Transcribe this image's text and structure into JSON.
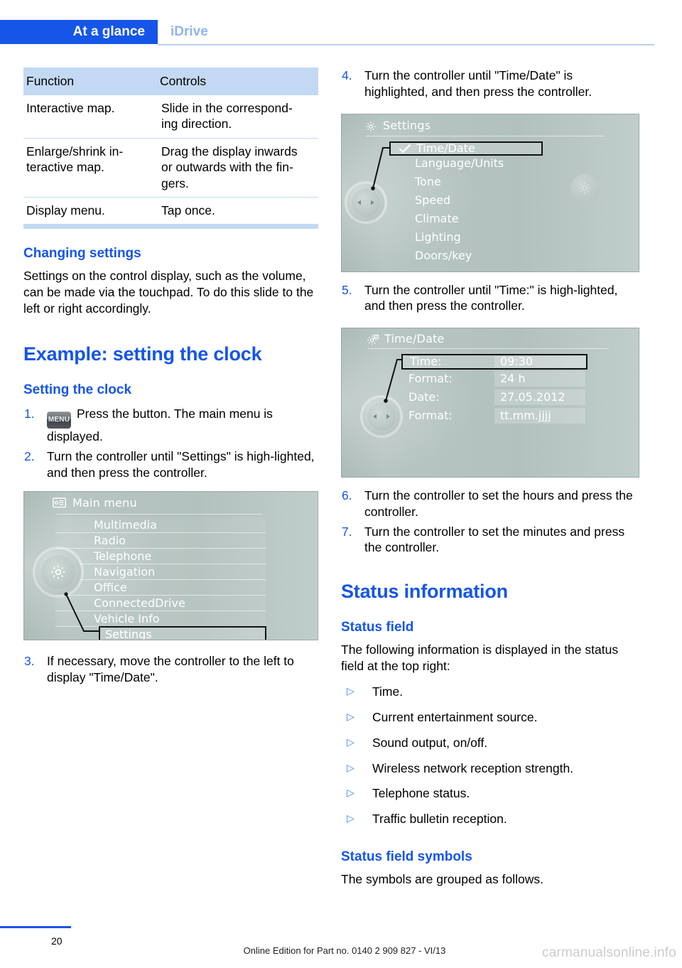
{
  "header": {
    "active_tab": "At a glance",
    "inactive_tab": "iDrive",
    "accent_color": "#1555e8"
  },
  "left_column": {
    "table": {
      "columns": [
        "Function",
        "Controls"
      ],
      "rows": [
        [
          "Interactive map.",
          "Slide in the correspond-\ning direction."
        ],
        [
          "Enlarge/shrink in-\nteractive map.",
          "Drag the display inwards\nor outwards with the fin-\ngers."
        ],
        [
          "Display menu.",
          "Tap once."
        ]
      ]
    },
    "changing_settings": {
      "heading": "Changing settings",
      "body": "Settings on the control display, such as the volume, can be made via the touchpad. To do this slide to the left or right accordingly."
    },
    "example_heading": "Example: setting the clock",
    "setting_clock_heading": "Setting the clock",
    "steps": [
      {
        "num": "1.",
        "key_label": "MENU",
        "text": "Press the button. The main menu is displayed."
      },
      {
        "num": "2.",
        "text": "Turn the controller until \"Settings\" is high-lighted, and then press the controller."
      },
      {
        "num": "3.",
        "text": "If necessary, move the controller to the left to display \"Time/Date\"."
      }
    ],
    "main_menu_screen": {
      "title": "Main menu",
      "title_icon": "list-menu-icon",
      "knob_icon": "gear-icon",
      "items": [
        "Multimedia",
        "Radio",
        "Telephone",
        "Navigation",
        "Office",
        "ConnectedDrive",
        "Vehicle Info",
        "Settings"
      ],
      "highlighted": "Settings"
    }
  },
  "right_column": {
    "steps": [
      {
        "num": "4.",
        "text": "Turn the controller until \"Time/Date\" is highlighted, and then press the controller."
      },
      {
        "num": "5.",
        "text": "Turn the controller until \"Time:\" is high-lighted, and then press the controller."
      },
      {
        "num": "6.",
        "text": "Turn the controller to set the hours and press the controller."
      },
      {
        "num": "7.",
        "text": "Turn the controller to set the minutes and press the controller."
      }
    ],
    "settings_screen": {
      "title": "Settings",
      "title_icon": "gear-icon",
      "check_icon": "checkmark-icon",
      "knob_icon": "left-right-arrows-icon",
      "side_icon": "gear-icon",
      "items": [
        "Time/Date",
        "Language/Units",
        "Tone",
        "Speed",
        "Climate",
        "Lighting",
        "Doors/key"
      ],
      "highlighted": "Time/Date"
    },
    "timedate_screen": {
      "title": "Time/Date",
      "title_icon": "gear-clock-icon",
      "knob_icon": "left-right-arrows-icon",
      "rows": [
        {
          "label": "Time:",
          "value": "09:30",
          "highlighted": true
        },
        {
          "label": "Format:",
          "value": "24 h",
          "highlighted": false
        },
        {
          "label": "Date:",
          "value": "27.05.2012",
          "highlighted": false
        },
        {
          "label": "Format:",
          "value": "tt.mm.jjjj",
          "highlighted": false
        }
      ]
    },
    "status_information_heading": "Status information",
    "status_field_heading": "Status field",
    "status_field_body": "The following information is displayed in the status field at the top right:",
    "status_bullets": [
      "Time.",
      "Current entertainment source.",
      "Sound output, on/off.",
      "Wireless network reception strength.",
      "Telephone status.",
      "Traffic bulletin reception."
    ],
    "status_symbols_heading": "Status field symbols",
    "status_symbols_body": "The symbols are grouped as follows."
  },
  "footer": {
    "page_number": "20",
    "edition_note": "Online Edition for Part no. 0140 2 909 827 - VI/13",
    "watermark": "carmanualsonline.info"
  }
}
